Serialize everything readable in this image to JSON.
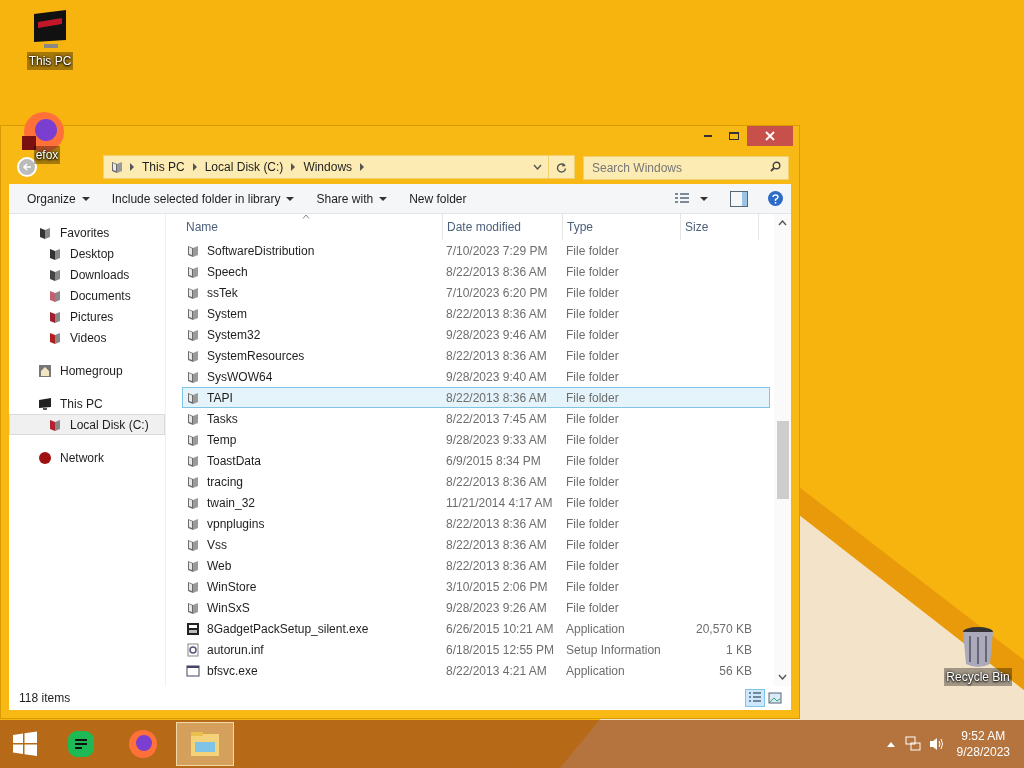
{
  "desktop_icons": [
    {
      "label": "This PC",
      "kind": "pc"
    },
    {
      "label": "efox",
      "kind": "browser"
    },
    {
      "label": "Recycle Bin",
      "kind": "bin"
    }
  ],
  "window": {
    "address_bar": {
      "crumbs": [
        "This PC",
        "Local Disk (C:)",
        "Windows"
      ]
    },
    "search": {
      "placeholder": "Search Windows"
    },
    "toolbar": [
      {
        "label": "Organize",
        "dropdown": true
      },
      {
        "label": "Include selected folder in library",
        "dropdown": true
      },
      {
        "label": "Share with",
        "dropdown": true
      },
      {
        "label": "New folder",
        "dropdown": false
      }
    ],
    "nav": [
      {
        "label": "Favorites",
        "kind": "star",
        "selected": false,
        "children": [
          {
            "label": "Desktop",
            "kind": "desktop",
            "selected": false
          },
          {
            "label": "Downloads",
            "kind": "downloads",
            "selected": false
          },
          {
            "label": "Documents",
            "kind": "documents",
            "selected": false
          },
          {
            "label": "Pictures",
            "kind": "pictures",
            "selected": false
          },
          {
            "label": "Videos",
            "kind": "videos",
            "selected": false
          }
        ]
      },
      {
        "label": "Homegroup",
        "kind": "home",
        "selected": false
      },
      {
        "label": "This PC",
        "kind": "pc",
        "selected": false,
        "children": [
          {
            "label": "Local Disk (C:)",
            "kind": "disk",
            "selected": true
          }
        ]
      },
      {
        "label": "Network",
        "kind": "network",
        "selected": false
      }
    ],
    "columns": [
      "Name",
      "Date modified",
      "Type",
      "Size"
    ],
    "rows": [
      {
        "name": "SoftwareDistribution",
        "date": "7/10/2023 7:29 PM",
        "type": "File folder",
        "size": "",
        "kind": "folder",
        "selected": false
      },
      {
        "name": "Speech",
        "date": "8/22/2013 8:36 AM",
        "type": "File folder",
        "size": "",
        "kind": "folder",
        "selected": false
      },
      {
        "name": "ssTek",
        "date": "7/10/2023 6:20 PM",
        "type": "File folder",
        "size": "",
        "kind": "folder",
        "selected": false
      },
      {
        "name": "System",
        "date": "8/22/2013 8:36 AM",
        "type": "File folder",
        "size": "",
        "kind": "folder",
        "selected": false
      },
      {
        "name": "System32",
        "date": "9/28/2023 9:46 AM",
        "type": "File folder",
        "size": "",
        "kind": "folder",
        "selected": false
      },
      {
        "name": "SystemResources",
        "date": "8/22/2013 8:36 AM",
        "type": "File folder",
        "size": "",
        "kind": "folder",
        "selected": false
      },
      {
        "name": "SysWOW64",
        "date": "9/28/2023 9:40 AM",
        "type": "File folder",
        "size": "",
        "kind": "folder",
        "selected": false
      },
      {
        "name": "TAPI",
        "date": "8/22/2013 8:36 AM",
        "type": "File folder",
        "size": "",
        "kind": "folder",
        "selected": true
      },
      {
        "name": "Tasks",
        "date": "8/22/2013 7:45 AM",
        "type": "File folder",
        "size": "",
        "kind": "folder",
        "selected": false
      },
      {
        "name": "Temp",
        "date": "9/28/2023 9:33 AM",
        "type": "File folder",
        "size": "",
        "kind": "folder",
        "selected": false
      },
      {
        "name": "ToastData",
        "date": "6/9/2015 8:34 PM",
        "type": "File folder",
        "size": "",
        "kind": "folder",
        "selected": false
      },
      {
        "name": "tracing",
        "date": "8/22/2013 8:36 AM",
        "type": "File folder",
        "size": "",
        "kind": "folder",
        "selected": false
      },
      {
        "name": "twain_32",
        "date": "11/21/2014 4:17 AM",
        "type": "File folder",
        "size": "",
        "kind": "folder",
        "selected": false
      },
      {
        "name": "vpnplugins",
        "date": "8/22/2013 8:36 AM",
        "type": "File folder",
        "size": "",
        "kind": "folder",
        "selected": false
      },
      {
        "name": "Vss",
        "date": "8/22/2013 8:36 AM",
        "type": "File folder",
        "size": "",
        "kind": "folder",
        "selected": false
      },
      {
        "name": "Web",
        "date": "8/22/2013 8:36 AM",
        "type": "File folder",
        "size": "",
        "kind": "folder",
        "selected": false
      },
      {
        "name": "WinStore",
        "date": "3/10/2015 2:06 PM",
        "type": "File folder",
        "size": "",
        "kind": "folder",
        "selected": false
      },
      {
        "name": "WinSxS",
        "date": "9/28/2023 9:26 AM",
        "type": "File folder",
        "size": "",
        "kind": "folder",
        "selected": false
      },
      {
        "name": "8GadgetPackSetup_silent.exe",
        "date": "6/26/2015 10:21 AM",
        "type": "Application",
        "size": "20,570 KB",
        "kind": "archive",
        "selected": false
      },
      {
        "name": "autorun.inf",
        "date": "6/18/2015 12:55 PM",
        "type": "Setup Information",
        "size": "1 KB",
        "kind": "settings",
        "selected": false
      },
      {
        "name": "bfsvc.exe",
        "date": "8/22/2013 4:21 AM",
        "type": "Application",
        "size": "56 KB",
        "kind": "app",
        "selected": false
      }
    ],
    "status_bar": {
      "count": "118 items",
      "views": [
        {
          "kind": "details",
          "selected": true
        },
        {
          "kind": "thumbnails",
          "selected": false
        }
      ]
    }
  },
  "taskbar": {
    "apps": [
      {
        "kind": "notes",
        "selected": false
      },
      {
        "kind": "browser",
        "selected": false
      },
      {
        "kind": "explorer",
        "selected": true
      }
    ],
    "time": "9:52 AM",
    "date": "9/28/2023"
  }
}
